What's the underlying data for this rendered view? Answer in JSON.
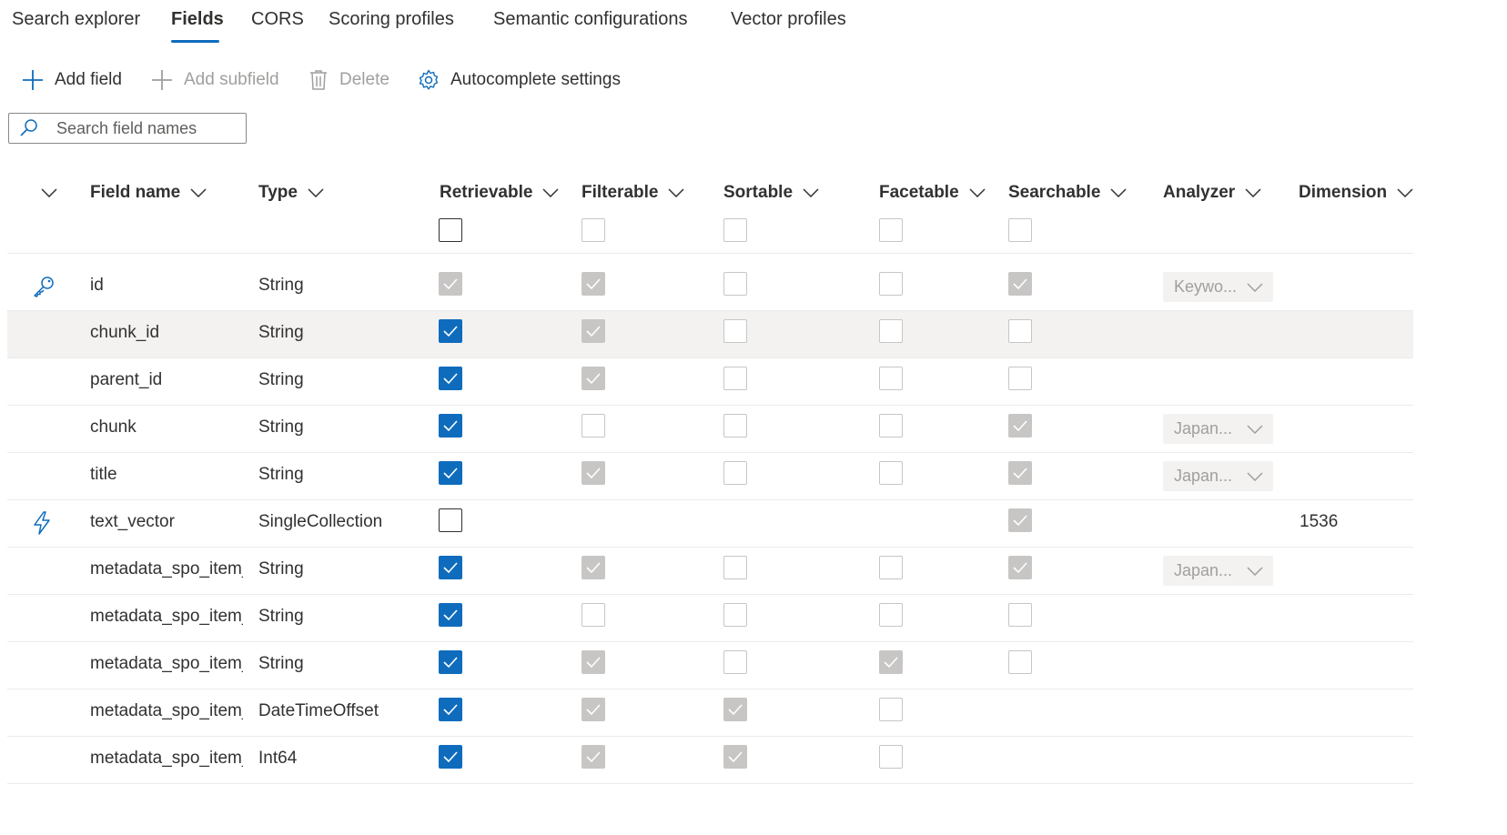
{
  "tabs": [
    {
      "label": "Search explorer",
      "active": false
    },
    {
      "label": "Fields",
      "active": true
    },
    {
      "label": "CORS",
      "active": false
    },
    {
      "label": "Scoring profiles",
      "active": false
    },
    {
      "label": "Semantic configurations",
      "active": false
    },
    {
      "label": "Vector profiles",
      "active": false
    }
  ],
  "toolbar": {
    "add_field": "Add field",
    "add_subfield": "Add subfield",
    "delete": "Delete",
    "autocomplete": "Autocomplete settings"
  },
  "search": {
    "placeholder": "Search field names",
    "value": ""
  },
  "columns": {
    "field_name": "Field name",
    "type": "Type",
    "retrievable": "Retrievable",
    "filterable": "Filterable",
    "sortable": "Sortable",
    "facetable": "Facetable",
    "searchable": "Searchable",
    "analyzer": "Analyzer",
    "dimension": "Dimension"
  },
  "header_checkboxes": {
    "retrievable": false,
    "filterable": false,
    "sortable": false,
    "facetable": false,
    "searchable": false
  },
  "colors": {
    "accent": "#0f6cbd",
    "disabled_check": "#c8c6c4",
    "selected_row": "#f3f2f1",
    "text": "#323130"
  },
  "rows": [
    {
      "icon": "key-icon",
      "name": "id",
      "type": "String",
      "retrievable": "dis",
      "filterable": "dis",
      "sortable": "off",
      "facetable": "off",
      "searchable": "dis",
      "analyzer": "Keywo...",
      "dimension": "",
      "selected": false
    },
    {
      "icon": "",
      "name": "chunk_id",
      "type": "String",
      "retrievable": "on",
      "filterable": "dis",
      "sortable": "off",
      "facetable": "off",
      "searchable": "off",
      "analyzer": "",
      "dimension": "",
      "selected": true
    },
    {
      "icon": "",
      "name": "parent_id",
      "type": "String",
      "retrievable": "on",
      "filterable": "dis",
      "sortable": "off",
      "facetable": "off",
      "searchable": "off",
      "analyzer": "",
      "dimension": "",
      "selected": false
    },
    {
      "icon": "",
      "name": "chunk",
      "type": "String",
      "retrievable": "on",
      "filterable": "off",
      "sortable": "off",
      "facetable": "off",
      "searchable": "dis",
      "analyzer": "Japan...",
      "dimension": "",
      "selected": false
    },
    {
      "icon": "",
      "name": "title",
      "type": "String",
      "retrievable": "on",
      "filterable": "dis",
      "sortable": "off",
      "facetable": "off",
      "searchable": "dis",
      "analyzer": "Japan...",
      "dimension": "",
      "selected": false
    },
    {
      "icon": "lightning-icon",
      "name": "text_vector",
      "type": "SingleCollection",
      "retrievable": "off-active",
      "filterable": "none",
      "sortable": "none",
      "facetable": "none",
      "searchable": "dis",
      "analyzer": "",
      "dimension": "1536",
      "selected": false
    },
    {
      "icon": "",
      "name": "metadata_spo_item_",
      "type": "String",
      "retrievable": "on",
      "filterable": "dis",
      "sortable": "off",
      "facetable": "off",
      "searchable": "dis",
      "analyzer": "Japan...",
      "dimension": "",
      "selected": false
    },
    {
      "icon": "",
      "name": "metadata_spo_item_",
      "type": "String",
      "retrievable": "on",
      "filterable": "off",
      "sortable": "off",
      "facetable": "off",
      "searchable": "off",
      "analyzer": "",
      "dimension": "",
      "selected": false
    },
    {
      "icon": "",
      "name": "metadata_spo_item_",
      "type": "String",
      "retrievable": "on",
      "filterable": "dis",
      "sortable": "off",
      "facetable": "dis",
      "searchable": "off",
      "analyzer": "",
      "dimension": "",
      "selected": false
    },
    {
      "icon": "",
      "name": "metadata_spo_item_",
      "type": "DateTimeOffset",
      "retrievable": "on",
      "filterable": "dis",
      "sortable": "dis",
      "facetable": "off",
      "searchable": "none",
      "analyzer": "",
      "dimension": "",
      "selected": false
    },
    {
      "icon": "",
      "name": "metadata_spo_item_",
      "type": "Int64",
      "retrievable": "on",
      "filterable": "dis",
      "sortable": "dis",
      "facetable": "off",
      "searchable": "none",
      "analyzer": "",
      "dimension": "",
      "selected": false
    }
  ]
}
